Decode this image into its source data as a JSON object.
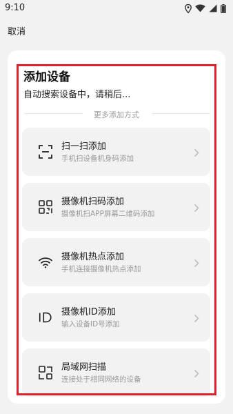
{
  "status_bar": {
    "time": "9:10",
    "icons": [
      "location-icon",
      "wifi-icon",
      "signal-icon",
      "battery-icon"
    ]
  },
  "header": {
    "cancel_label": "取消"
  },
  "main": {
    "title": "添加设备",
    "search_status": "自动搜索设备中，请稍后...",
    "more_methods_label": "更多添加方式",
    "options": [
      {
        "title": "扫一扫添加",
        "subtitle": "手机扫设备机身码添加",
        "icon": "scan-frame-icon"
      },
      {
        "title": "摄像机扫码添加",
        "subtitle": "摄像机扫APP屏幕二维码添加",
        "icon": "qr-code-icon"
      },
      {
        "title": "摄像机热点添加",
        "subtitle": "手机连接摄像机热点添加",
        "icon": "wifi-icon"
      },
      {
        "title": "摄像机ID添加",
        "subtitle": "输入设备ID号添加",
        "icon": "id-icon"
      },
      {
        "title": "局域网扫描",
        "subtitle": "连接处于相同网络的设备",
        "icon": "lan-scan-icon"
      }
    ]
  },
  "colors": {
    "highlight": "#e0202a",
    "card_bg": "#ffffff",
    "option_bg": "#f2f2f2",
    "page_bg": "#f2f2f2"
  }
}
